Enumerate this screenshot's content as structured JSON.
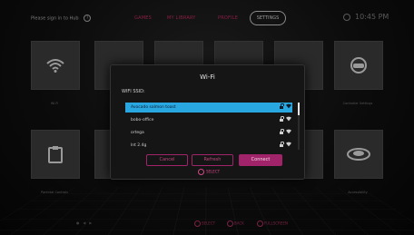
{
  "header": {
    "login_hint": "Please sign in to Hub",
    "tabs": [
      "GAMES",
      "MY LIBRARY",
      "PROFILE"
    ],
    "active_tab": "SETTINGS",
    "clock": "10:45 PM"
  },
  "tiles": [
    {
      "label": "Wi-Fi",
      "icon": "wifi-icon"
    },
    {
      "label": "",
      "icon": "sound-icon"
    },
    {
      "label": "",
      "icon": "briefcase-icon"
    },
    {
      "label": "",
      "icon": "display-icon"
    },
    {
      "label": "",
      "icon": "storage-icon"
    },
    {
      "label": "Controller Settings",
      "icon": "gamepad-icon"
    },
    {
      "label": "Parental Controls",
      "icon": "clipboard-icon"
    },
    {
      "label": "",
      "icon": "user-icon"
    },
    {
      "label": "",
      "icon": "media-icon"
    },
    {
      "label": "",
      "icon": "help-icon"
    },
    {
      "label": "",
      "icon": "info-icon"
    },
    {
      "label": "Accessibility",
      "icon": "disc-icon"
    }
  ],
  "dialog": {
    "title": "Wi-Fi",
    "ssid_label": "WIFI SSID:",
    "networks": [
      {
        "name": "Avocado salmon toast",
        "secured": true,
        "selected": true
      },
      {
        "name": "bobo-office",
        "secured": true,
        "selected": false
      },
      {
        "name": "ortega",
        "secured": true,
        "selected": false
      },
      {
        "name": "lnt 2.4g",
        "secured": true,
        "selected": false
      }
    ],
    "buttons": {
      "cancel": "Cancel",
      "refresh": "Refresh",
      "connect": "Connect"
    },
    "select_hint": "SELECT"
  },
  "footer": {
    "select": "SELECT",
    "back": "BACK",
    "fullscreen": "FULLSCREEN"
  },
  "colors": {
    "accent": "#a1246a",
    "selection": "#29a7e1",
    "dialog_bg": "#151515"
  }
}
